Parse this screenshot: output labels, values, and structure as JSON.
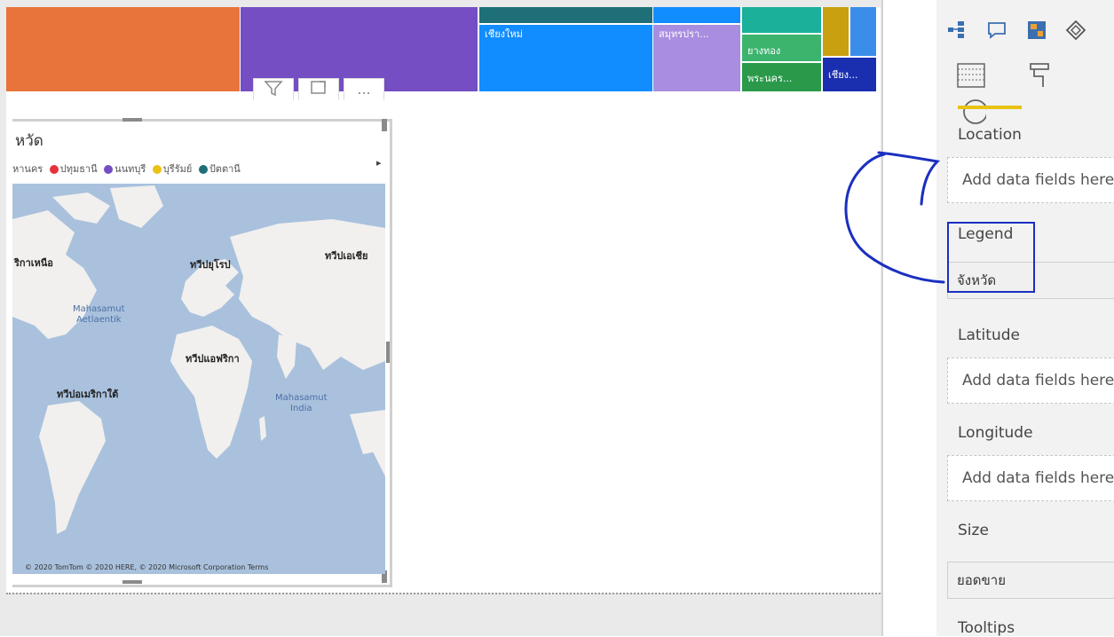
{
  "treemap": {
    "tiles": [
      {
        "label": "",
        "color": "#e8743b"
      },
      {
        "label": "",
        "color": "#744ec2"
      },
      {
        "label": "",
        "color": "#1f6f78"
      },
      {
        "label": "เชียงใหม่",
        "color": "#118dff"
      },
      {
        "label": "สมุทรปรา...",
        "color": "#a88de0"
      },
      {
        "label": "",
        "color": "#1ab09a"
      },
      {
        "label": "ยางทอง",
        "color": "#3cb46e"
      },
      {
        "label": "พระนคร...",
        "color": "#2a9a4a"
      },
      {
        "label": "",
        "color": "#c8a010"
      },
      {
        "label": "",
        "color": "#3b8dea"
      },
      {
        "label": "เชียง...",
        "color": "#1a2fb0"
      }
    ]
  },
  "visual_header": {
    "filter_icon": "filter-icon",
    "focus_icon": "focus-mode-icon",
    "more_label": "..."
  },
  "map": {
    "title": "หวัด",
    "legend": [
      {
        "label": "หานคร",
        "color": "#118dff"
      },
      {
        "label": "ปทุมธานี",
        "color": "#e8323b"
      },
      {
        "label": "นนทบุรี",
        "color": "#744ec2"
      },
      {
        "label": "บุรีรัมย์",
        "color": "#e8c313"
      },
      {
        "label": "ปัตตานี",
        "color": "#1f6f78"
      }
    ],
    "legend_arrow": "▸",
    "labels": {
      "north_america": "ริกาเหนือ",
      "europe": "ทวีปยุโรป",
      "asia": "ทวีปเอเชีย",
      "africa": "ทวีปแอฟริกา",
      "south_america": "ทวีปอเมริกาใต้"
    },
    "oceans": {
      "atlantic": "Mahasamut\nAetlaentik",
      "indian": "Mahasamut\nIndia"
    },
    "copyright": "© 2020 TomTom © 2020 HERE, © 2020 Microsoft Corporation  Terms"
  },
  "panel": {
    "icons": [
      "decomposition-tree-icon",
      "qa-icon",
      "smart-narrative-icon",
      "custom-visual-icon"
    ],
    "tabs": [
      "fields-tab-icon",
      "format-tab-icon",
      "analytics-tab-icon"
    ],
    "wells": {
      "location": {
        "label": "Location",
        "placeholder": "Add data fields here"
      },
      "legend": {
        "label": "Legend",
        "field": "จังหวัด"
      },
      "latitude": {
        "label": "Latitude",
        "placeholder": "Add data fields here"
      },
      "longitude": {
        "label": "Longitude",
        "placeholder": "Add data fields here"
      },
      "size": {
        "label": "Size",
        "field": "ยอดขาย"
      },
      "tooltips": {
        "label": "Tooltips"
      }
    }
  },
  "colors": {
    "annotation_blue": "#1a2fc0",
    "tab_accent": "#e8c313",
    "map_water": "#a9c1dd"
  }
}
